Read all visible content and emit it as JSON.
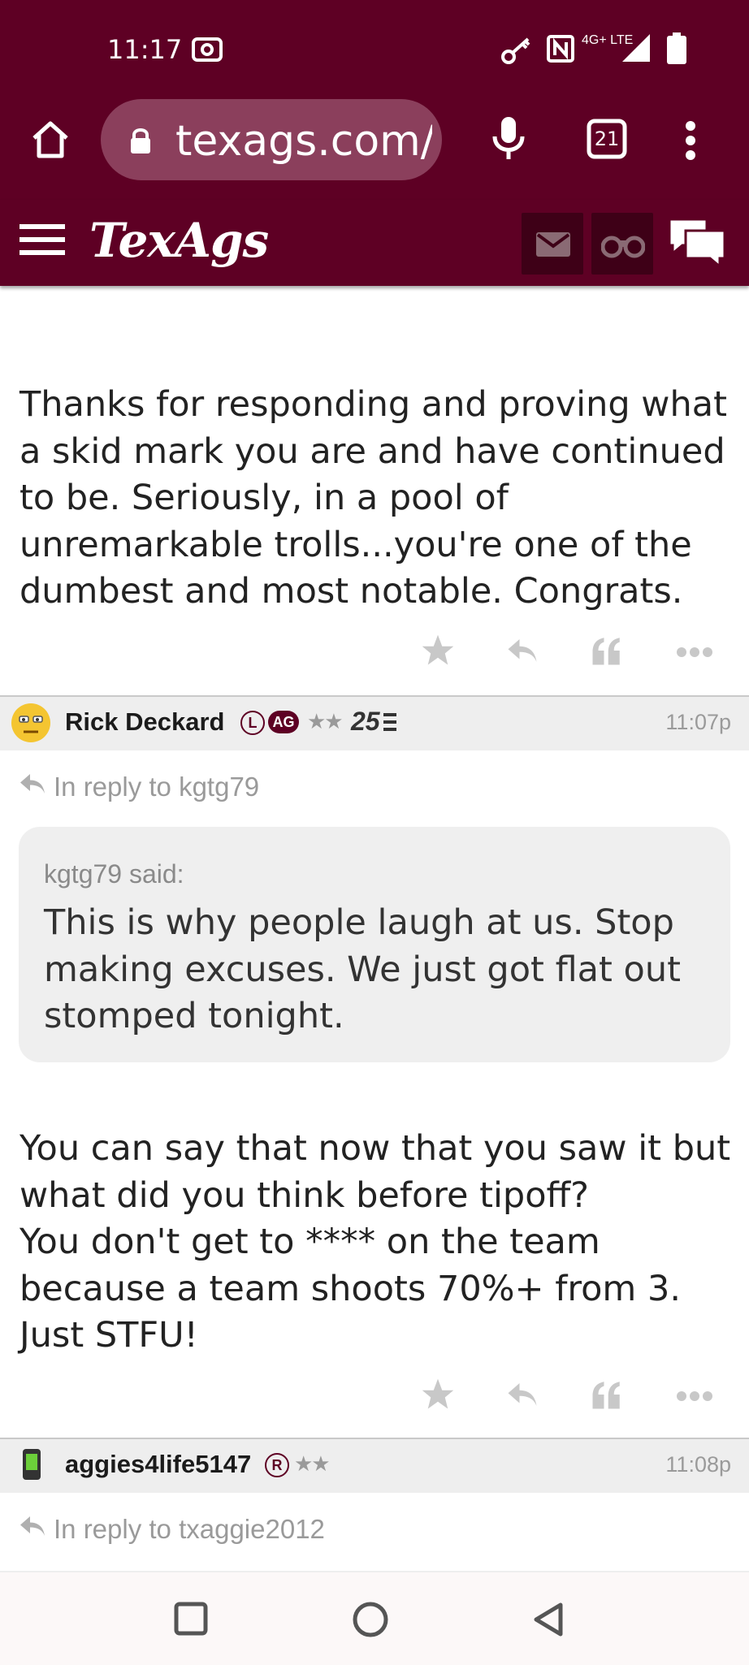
{
  "status_bar": {
    "time": "11:17",
    "network": "4G+ LTE",
    "icons": [
      "screen-record-icon",
      "vpn-key-icon",
      "nfc-icon",
      "signal-icon",
      "battery-icon"
    ]
  },
  "browser": {
    "url": "texags.com/",
    "tab_count": "21",
    "icons": [
      "home-icon",
      "lock-icon",
      "mic-icon",
      "tabs-icon",
      "more-vert-icon"
    ]
  },
  "site_header": {
    "logo": "TexAgs",
    "icons": [
      "hamburger-menu-icon",
      "mail-icon",
      "binoculars-icon",
      "chat-bubbles-icon"
    ]
  },
  "posts": [
    {
      "body": "Thanks for responding and proving what a skid mark you are and have continued to be. Seriously, in a pool of unremarkable trolls...you're one of the dumbest and most notable. Congrats."
    },
    {
      "author": "Rick Deckard",
      "badges": [
        "L",
        "AG"
      ],
      "stars": "★★",
      "rank": "25",
      "time": "11:07p",
      "reply_to": "In reply to kgtg79",
      "quote_author": "kgtg79 said:",
      "quote": "This is why people laugh at us. Stop making excuses. We just got flat out stomped tonight.",
      "body_lines": [
        "You can say that now that you saw it but what did you think before tipoff?",
        "You don't get to **** on the team because a team shoots 70%+ from 3. Just STFU!"
      ]
    },
    {
      "author": "aggies4life5147",
      "badges": [
        "R"
      ],
      "stars": "★★",
      "time": "11:08p",
      "reply_to": "In reply to txaggie2012"
    }
  ],
  "colors": {
    "maroon": "#5e0024",
    "url_pill": "#8b3f5c",
    "action_gray": "#c8c8c8",
    "meta_gray": "#9a9a9a"
  }
}
